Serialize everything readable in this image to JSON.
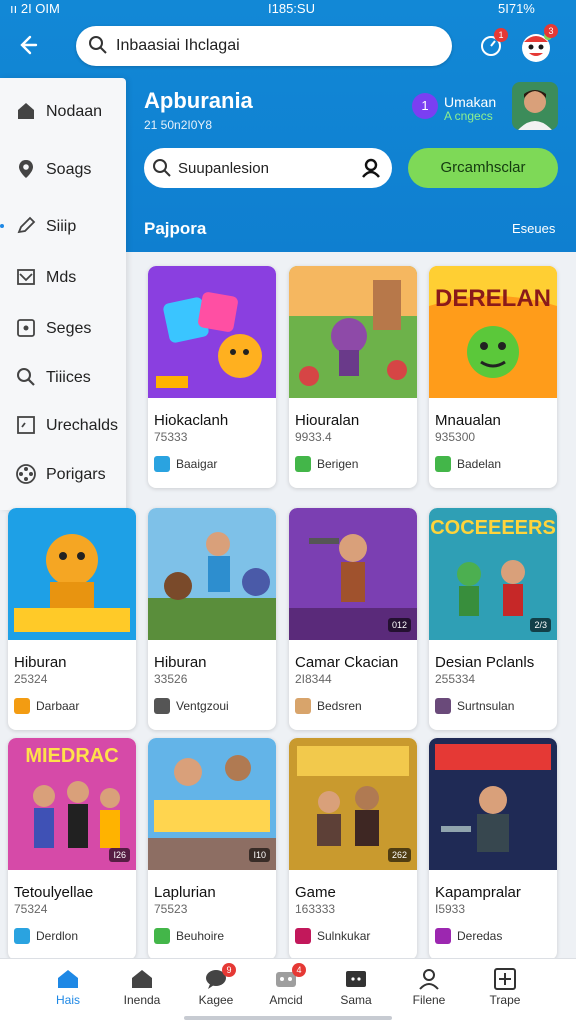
{
  "status": {
    "time": "I185:SU",
    "left": "ıı 2I OIM",
    "battery": "5I71%"
  },
  "header": {
    "search_text": "Inbaasiai Ihclagai",
    "badge_a": "1",
    "badge_b": "3"
  },
  "sidebar": {
    "items": [
      {
        "label": "Nodaan",
        "icon": "home-icon"
      },
      {
        "label": "Soags",
        "icon": "location-icon"
      },
      {
        "label": "Siiip",
        "icon": "edit-icon"
      },
      {
        "label": "Mds",
        "icon": "mail-icon"
      },
      {
        "label": "Seges",
        "icon": "square-icon"
      },
      {
        "label": "Tiiices",
        "icon": "search-icon"
      },
      {
        "label": "Urechalds",
        "icon": "note-icon"
      },
      {
        "label": "Porigars",
        "icon": "film-icon"
      }
    ]
  },
  "main": {
    "title": "Apburania",
    "subtitle": "21 50n2I0Y8",
    "user": {
      "num": "1",
      "name": "Umakan",
      "sub": "A cngecs"
    },
    "search_text": "Suupanlesion",
    "cta_label": "Grcamhsclar",
    "section_title": "Pajpora",
    "section_more": "Eseues"
  },
  "cards": [
    {
      "name": "Hiokaclanh",
      "num": "75333",
      "dev": "Baaigar",
      "tag": "",
      "dev_color": "#2aa3e0"
    },
    {
      "name": "Hiouralan",
      "num": "9933.4",
      "dev": "Berigen",
      "tag": "",
      "dev_color": "#43b649"
    },
    {
      "name": "Mnaualan",
      "num": "935300",
      "dev": "Badelan",
      "tag": "",
      "dev_color": "#43b649"
    },
    {
      "name": "Hiburan",
      "num": "25324",
      "dev": "Darbaar",
      "tag": "",
      "dev_color": "#f39c12"
    },
    {
      "name": "Hiburan",
      "num": "33526",
      "dev": "Ventgzoui",
      "tag": "",
      "dev_color": "#555"
    },
    {
      "name": "Camar Ckacian",
      "num": "2I8344",
      "dev": "Bedsren",
      "tag": "012",
      "dev_color": "#d8a46b"
    },
    {
      "name": "Desian Pclanls",
      "num": "255334",
      "dev": "Surtnsulan",
      "tag": "2/3",
      "dev_color": "#6a4a7a"
    },
    {
      "name": "Tetoulyellae",
      "num": "75324",
      "dev": "Derdlon",
      "tag": "I26",
      "dev_color": "#2aa3e0"
    },
    {
      "name": "Laplurian",
      "num": "75523",
      "dev": "Beuhoire",
      "tag": "I10",
      "dev_color": "#43b649"
    },
    {
      "name": "Game",
      "num": "163333",
      "dev": "Sulnkukar",
      "tag": "262",
      "dev_color": "#c2185b"
    },
    {
      "name": "Kapampralar",
      "num": "I5933",
      "dev": "Deredas",
      "tag": "",
      "dev_color": "#9c27b0"
    }
  ],
  "bottom_nav": [
    {
      "label": "Hais",
      "icon": "home-icon",
      "active": true
    },
    {
      "label": "Inenda",
      "icon": "house-icon"
    },
    {
      "label": "Kagee",
      "icon": "chat-icon",
      "badge": "9"
    },
    {
      "label": "Amcid",
      "icon": "game-icon",
      "badge": "4"
    },
    {
      "label": "Sama",
      "icon": "tv-icon"
    },
    {
      "label": "Filene",
      "icon": "person-icon"
    },
    {
      "label": "Trape",
      "icon": "grid-icon"
    }
  ],
  "colors": {
    "primary": "#1288d6",
    "accent": "#7ed957",
    "active_nav": "#1e88e5"
  }
}
